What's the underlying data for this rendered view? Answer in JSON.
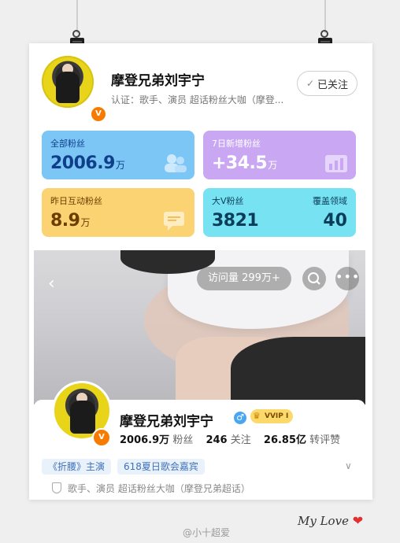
{
  "profile_header": {
    "name": "摩登兄弟刘宇宁",
    "verification": "认证：歌手、演员 超话粉丝大咖（摩登...",
    "follow_label": "已关注",
    "vip_badge": "V"
  },
  "stats": {
    "total_fans_label": "全部粉丝",
    "total_fans_value": "2006.9",
    "total_fans_unit": "万",
    "new_fans_7d_label": "7日新增粉丝",
    "new_fans_7d_value": "+34.5",
    "new_fans_7d_unit": "万",
    "interact_fans_label": "昨日互动粉丝",
    "interact_fans_value": "8.9",
    "interact_fans_unit": "万",
    "bigv_label": "大V粉丝",
    "bigv_value": "3821",
    "coverage_label": "覆盖领域",
    "coverage_value": "40"
  },
  "banner": {
    "visits_label": "访问量 299万+"
  },
  "profile": {
    "name": "摩登兄弟刘宇宁",
    "gender_symbol": "♂",
    "vvip_label": "VVIP I",
    "fans_count": "2006.9万",
    "fans_label": "粉丝",
    "following_count": "246",
    "following_label": "关注",
    "likes_count": "26.85亿",
    "likes_label": "转评赞",
    "tags": [
      "《折腰》主演",
      "618夏日歌会嘉宾"
    ],
    "verification": "歌手、演员 超话粉丝大咖（摩登兄弟超话）"
  },
  "footer": {
    "watermark": "@小十超爱",
    "signature": "My Love",
    "heart": "❤"
  }
}
